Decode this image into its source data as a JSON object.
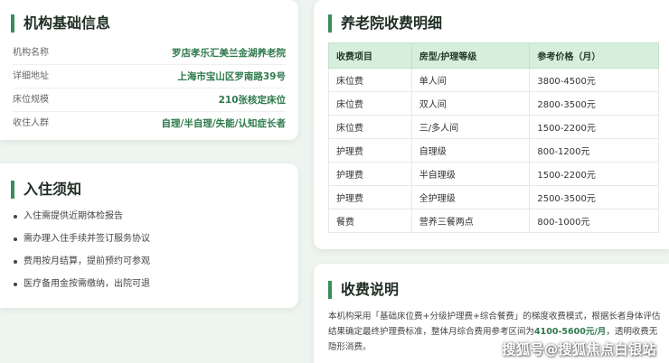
{
  "basic_info": {
    "title": "机构基础信息",
    "rows": [
      {
        "label": "机构名称",
        "value": "罗店孝乐汇美兰金湖养老院"
      },
      {
        "label": "详细地址",
        "value": "上海市宝山区罗南路39号"
      },
      {
        "label": "床位规模",
        "value": "210张核定床位"
      },
      {
        "label": "收住人群",
        "value": "自理/半自理/失能/认知症长者"
      }
    ]
  },
  "notice": {
    "title": "入住须知",
    "items": [
      "入住需提供近期体检报告",
      "需办理入住手续并签订服务协议",
      "费用按月结算，提前预约可参观",
      "医疗备用金按需缴纳，出院可退"
    ]
  },
  "fees": {
    "title": "养老院收费明细",
    "headers": [
      "收费项目",
      "房型/护理等级",
      "参考价格（月）"
    ],
    "rows": [
      [
        "床位费",
        "单人间",
        "3800-4500元"
      ],
      [
        "床位费",
        "双人间",
        "2800-3500元"
      ],
      [
        "床位费",
        "三/多人间",
        "1500-2200元"
      ],
      [
        "护理费",
        "自理级",
        "800-1200元"
      ],
      [
        "护理费",
        "半自理级",
        "1500-2200元"
      ],
      [
        "护理费",
        "全护理级",
        "2500-3500元"
      ],
      [
        "餐费",
        "营养三餐两点",
        "800-1000元"
      ]
    ]
  },
  "explain": {
    "title": "收费说明",
    "text_before": "本机构采用「基础床位费+分级护理费+综合餐费」的梯度收费模式，根据长者身体评估结果确定最终护理费标准，整体月综合费用参考区间为",
    "highlight": "4100-5600元/月",
    "text_after": "，透明收费无隐形消费。"
  },
  "watermark": "搜狐号@搜狐焦点白银站",
  "colors": {
    "accent": "#3a8d5c",
    "value_text": "#2f7a4c",
    "table_header": "#d6efdc",
    "background": "#eef4ef"
  }
}
